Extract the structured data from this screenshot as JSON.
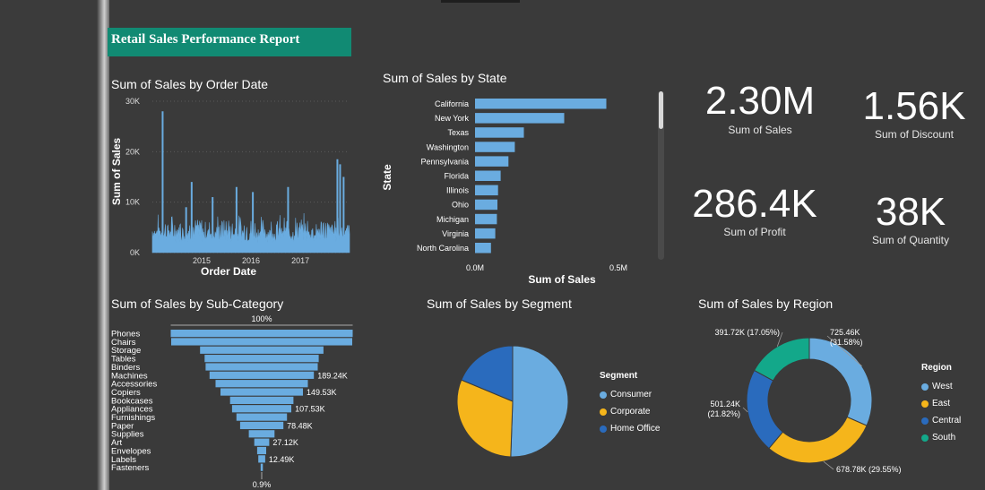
{
  "report": {
    "title": "Retail Sales Performance Report"
  },
  "visuals": {
    "sales_by_date_title": "Sum of Sales by Order Date",
    "sales_by_state_title": "Sum of Sales by State",
    "sales_by_subcategory_title": "Sum of Sales by Sub-Category",
    "sales_by_segment_title": "Sum of Sales by Segment",
    "sales_by_region_title": "Sum of Sales by Region"
  },
  "kpis": [
    {
      "value": "2.30M",
      "label": "Sum of Sales"
    },
    {
      "value": "1.56K",
      "label": "Sum of Discount"
    },
    {
      "value": "286.4K",
      "label": "Sum of Profit"
    },
    {
      "value": "38K",
      "label": "Sum of Quantity"
    }
  ],
  "colors": {
    "background": "#3a3a3a",
    "banner": "#118a73",
    "bar": "#6aace0",
    "west": "#6aace0",
    "east": "#f5b51b",
    "central": "#2a6bbd",
    "south": "#13a88a"
  },
  "chart_data": [
    {
      "type": "line",
      "title": "Sum of Sales by Order Date",
      "xlabel": "Order Date",
      "ylabel": "Sum of Sales",
      "x_ticks": [
        "2015",
        "2016",
        "2017"
      ],
      "y_ticks": [
        "0K",
        "10K",
        "20K",
        "30K"
      ],
      "ylim": [
        0,
        30000
      ],
      "grid": true,
      "spikes": [
        {
          "date": "2014-03-18",
          "value": 28000
        },
        {
          "date": "2014-09-08",
          "value": 9000
        },
        {
          "date": "2014-10-19",
          "value": 14000
        },
        {
          "date": "2015-03-23",
          "value": 11000
        },
        {
          "date": "2015-09-16",
          "value": 13000
        },
        {
          "date": "2016-01-15",
          "value": 12000
        },
        {
          "date": "2016-10-02",
          "value": 13000
        },
        {
          "date": "2017-10-02",
          "value": 18500
        },
        {
          "date": "2017-10-22",
          "value": 17500
        },
        {
          "date": "2017-11-17",
          "value": 15000
        }
      ],
      "baseline_range": [
        2000,
        8000
      ]
    },
    {
      "type": "bar",
      "orientation": "horizontal",
      "title": "Sum of Sales by State",
      "xlabel": "Sum of Sales",
      "ylabel": "State",
      "categories": [
        "California",
        "New York",
        "Texas",
        "Washington",
        "Pennsylvania",
        "Florida",
        "Illinois",
        "Ohio",
        "Michigan",
        "Virginia",
        "North Carolina"
      ],
      "values": [
        457688,
        310876,
        170188,
        138641,
        116512,
        89474,
        80166,
        78258,
        76270,
        70637,
        55603
      ],
      "x_ticks": [
        "0.0M",
        "0.5M"
      ],
      "xlim": [
        0,
        500000
      ]
    },
    {
      "type": "bar",
      "orientation": "funnel",
      "title": "Sum of Sales by Sub-Category",
      "top_label": "100%",
      "bottom_label": "0.9%",
      "categories": [
        "Phones",
        "Chairs",
        "Storage",
        "Tables",
        "Binders",
        "Machines",
        "Accessories",
        "Copiers",
        "Bookcases",
        "Appliances",
        "Furnishings",
        "Paper",
        "Supplies",
        "Art",
        "Envelopes",
        "Labels",
        "Fasteners"
      ],
      "values": [
        330007,
        328449,
        223844,
        206966,
        203413,
        189239,
        167380,
        149528,
        114880,
        107532,
        91705,
        78479,
        46674,
        27119,
        16476,
        12486,
        3024
      ],
      "data_labels": {
        "5": "189.24K",
        "7": "149.53K",
        "9": "107.53K",
        "11": "78.48K",
        "13": "27.12K",
        "15": "12.49K"
      }
    },
    {
      "type": "pie",
      "title": "Sum of Sales by Segment",
      "legend_title": "Segment",
      "categories": [
        "Consumer",
        "Corporate",
        "Home Office"
      ],
      "values": [
        1161401,
        706146,
        429653
      ],
      "percent": [
        50.56,
        30.74,
        18.71
      ]
    },
    {
      "type": "pie",
      "donut": true,
      "title": "Sum of Sales by Region",
      "legend_title": "Region",
      "categories": [
        "West",
        "East",
        "Central",
        "South"
      ],
      "values": [
        725460,
        678780,
        501240,
        391720
      ],
      "labels": [
        "725.46K (31.58%)",
        "678.78K (29.55%)",
        "501.24K (21.82%)",
        "391.72K (17.05%)"
      ]
    }
  ]
}
